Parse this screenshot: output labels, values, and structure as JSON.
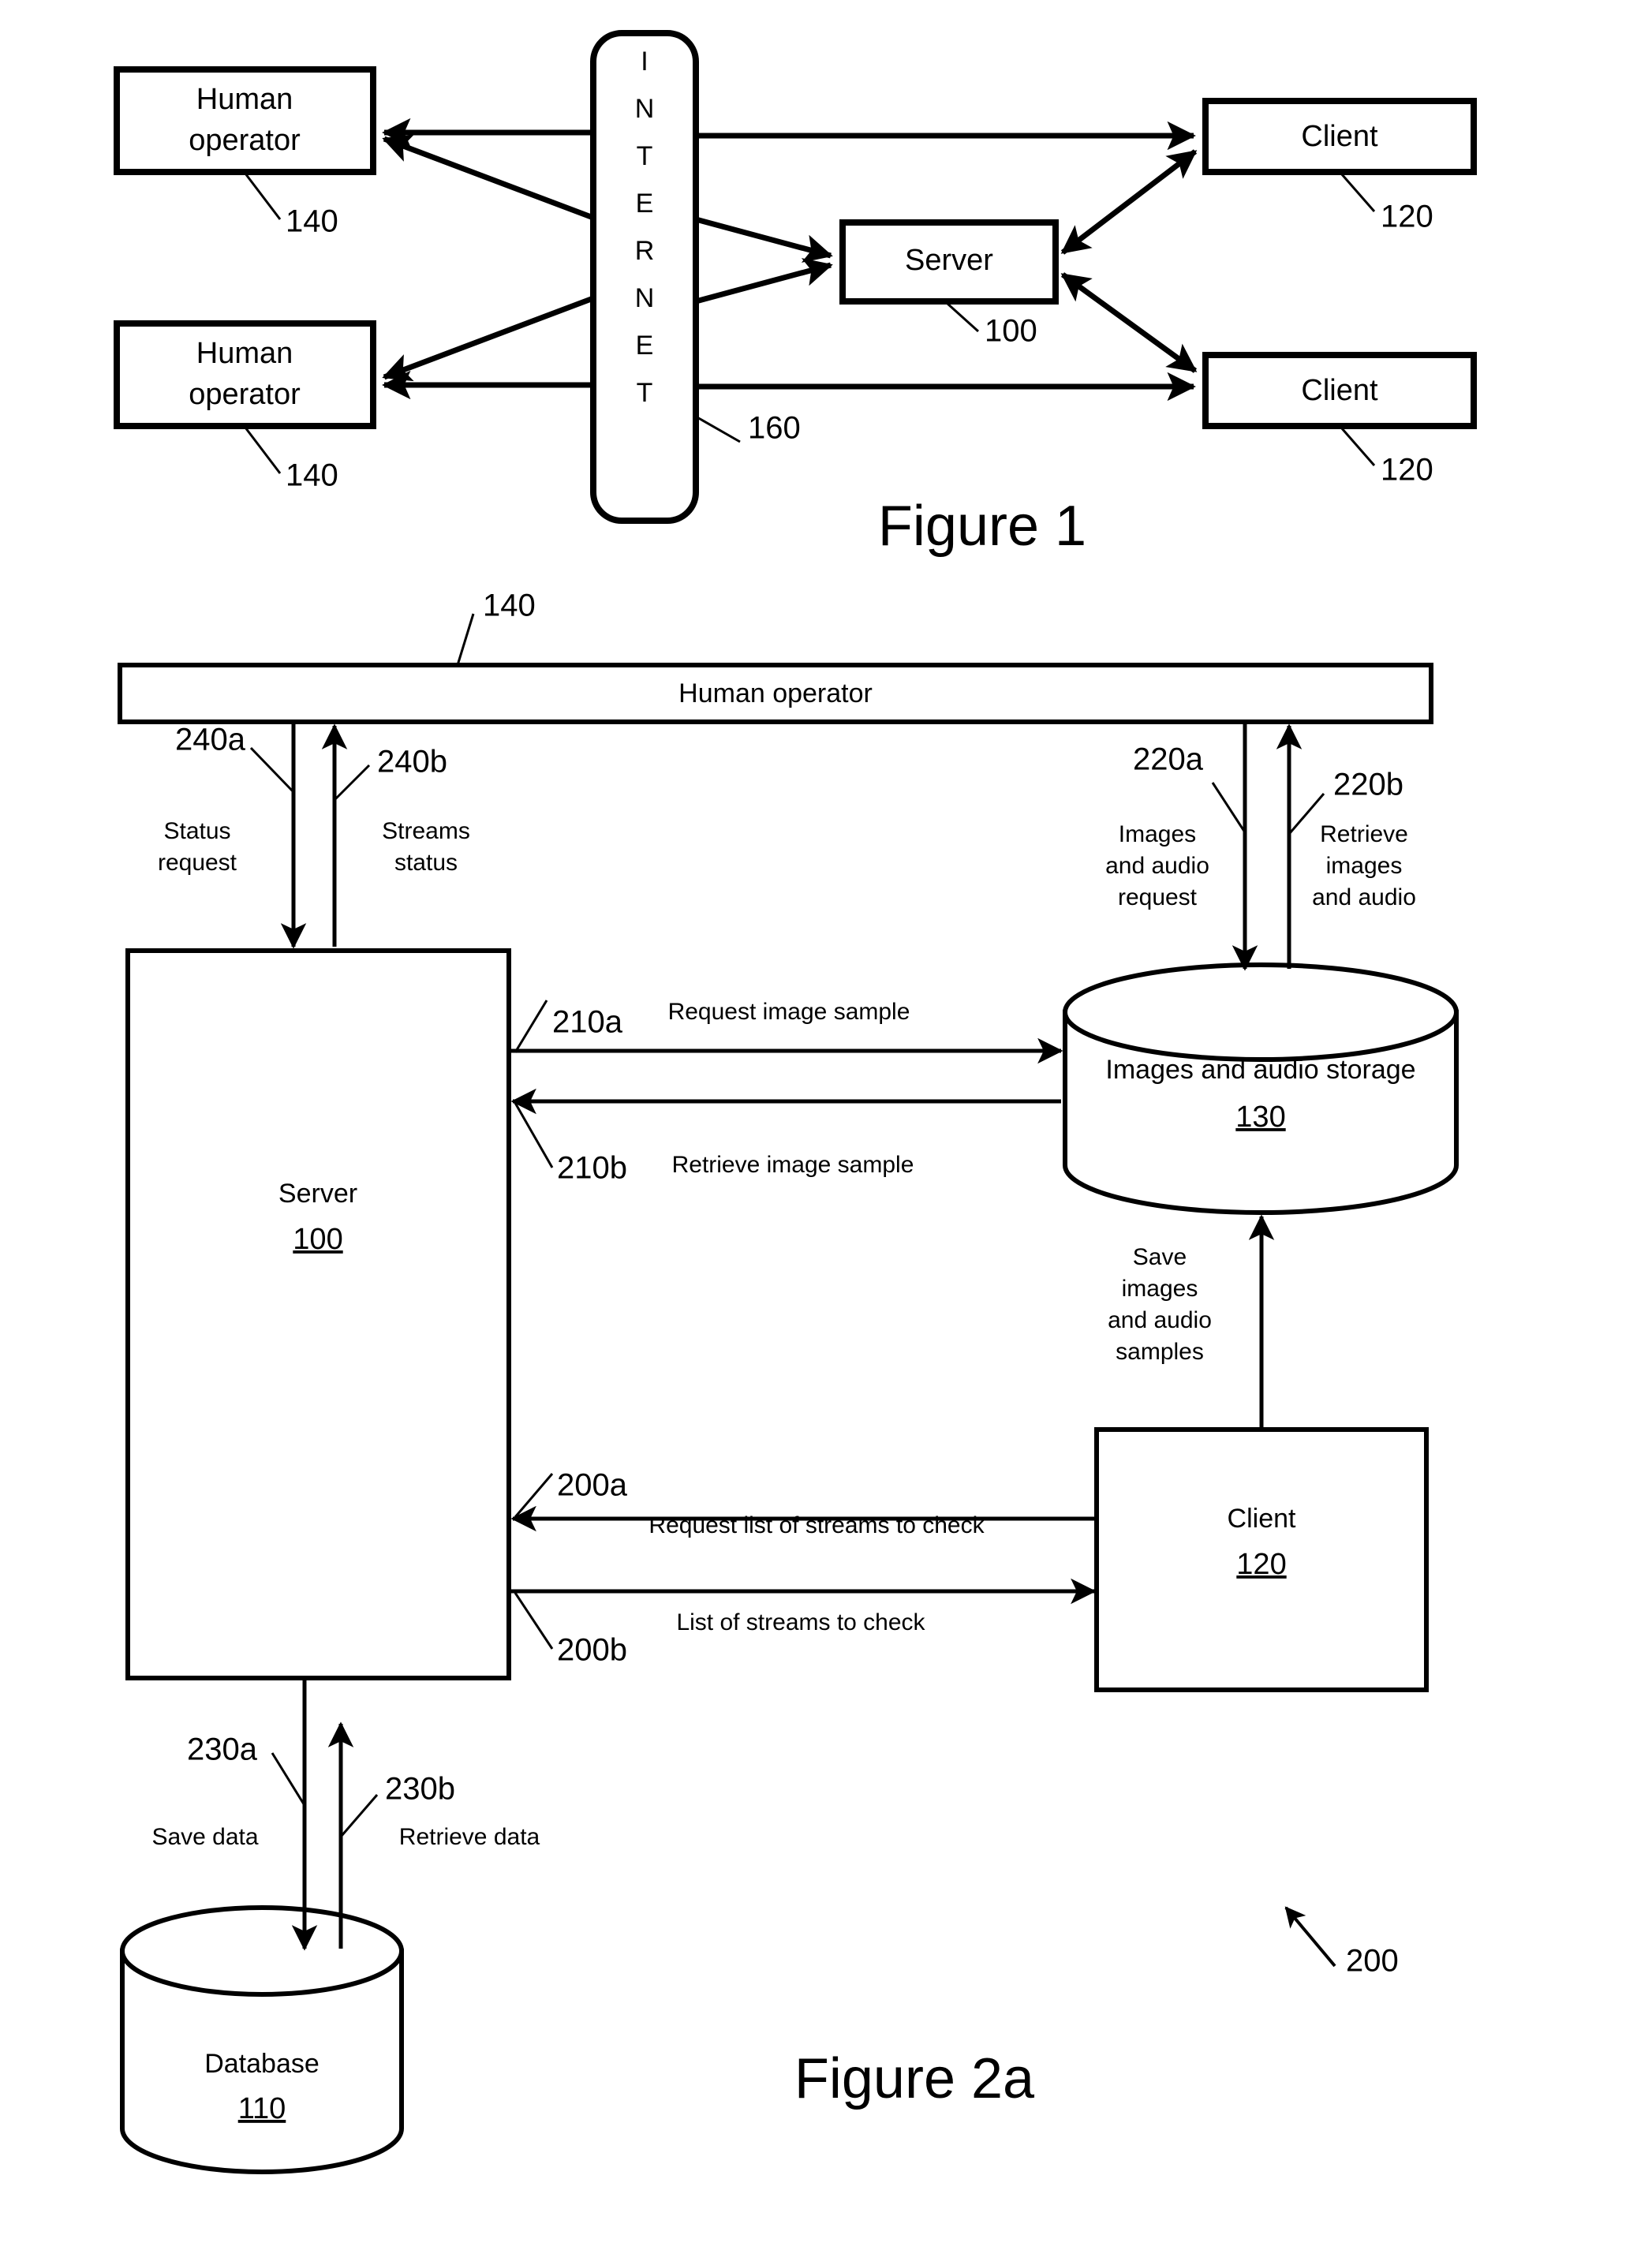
{
  "document": {
    "type": "patent-figure-sheet",
    "background_color": "#ffffff",
    "line_color": "#000000"
  },
  "figure1": {
    "caption": "Figure 1",
    "nodes": {
      "human_operator_top": {
        "label_line1": "Human",
        "label_line2": "operator",
        "ref": "140"
      },
      "human_operator_bottom": {
        "label_line1": "Human",
        "label_line2": "operator",
        "ref": "140"
      },
      "internet": {
        "letters": [
          "I",
          "N",
          "T",
          "E",
          "R",
          "N",
          "E",
          "T"
        ],
        "ref": "160"
      },
      "server": {
        "label": "Server",
        "ref": "100"
      },
      "client_top": {
        "label": "Client",
        "ref": "120"
      },
      "client_bottom": {
        "label": "Client",
        "ref": "120"
      }
    }
  },
  "figure2a": {
    "caption": "Figure 2a",
    "overall_ref": "200",
    "nodes": {
      "human_operator": {
        "label": "Human operator",
        "ref": "140"
      },
      "server": {
        "label": "Server",
        "ref": "100"
      },
      "images_audio_storage": {
        "label": "Images and audio storage",
        "ref": "130"
      },
      "client": {
        "label": "Client",
        "ref": "120"
      },
      "database": {
        "label": "Database",
        "ref": "110"
      }
    },
    "flows": [
      {
        "ref": "240a",
        "label_line1": "Status",
        "label_line2": "request",
        "from": "human-operator",
        "to": "server",
        "direction": "down"
      },
      {
        "ref": "240b",
        "label_line1": "Streams",
        "label_line2": "status",
        "from": "server",
        "to": "human-operator",
        "direction": "up"
      },
      {
        "ref": "220a",
        "label_line1": "Images",
        "label_line2": "and audio",
        "label_line3": "request",
        "from": "human-operator",
        "to": "images-audio-storage",
        "direction": "down"
      },
      {
        "ref": "220b",
        "label_line1": "Retrieve",
        "label_line2": "images",
        "label_line3": "and audio",
        "from": "images-audio-storage",
        "to": "human-operator",
        "direction": "up"
      },
      {
        "ref": "210a",
        "label": "Request image sample",
        "from": "server",
        "to": "images-audio-storage",
        "direction": "right"
      },
      {
        "ref": "210b",
        "label": "Retrieve image sample",
        "from": "images-audio-storage",
        "to": "server",
        "direction": "left"
      },
      {
        "ref": "",
        "label_line1": "Save",
        "label_line2": "images",
        "label_line3": "and audio",
        "label_line4": "samples",
        "from": "client",
        "to": "images-audio-storage",
        "direction": "up"
      },
      {
        "ref": "200a",
        "label": "Request list of streams to check",
        "from": "client",
        "to": "server",
        "direction": "left"
      },
      {
        "ref": "200b",
        "label": "List of streams to check",
        "from": "server",
        "to": "client",
        "direction": "right"
      },
      {
        "ref": "230a",
        "label": "Save data",
        "from": "server",
        "to": "database",
        "direction": "down"
      },
      {
        "ref": "230b",
        "label": "Retrieve data",
        "from": "database",
        "to": "server",
        "direction": "up"
      }
    ]
  }
}
